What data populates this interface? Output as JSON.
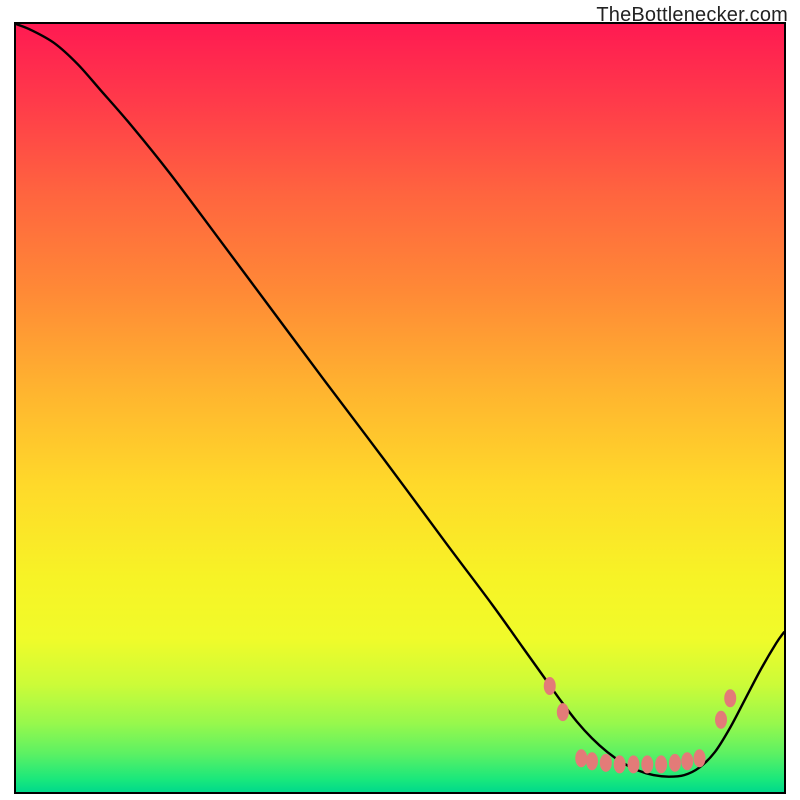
{
  "watermark": "TheBottleneсker.com",
  "chart_data": {
    "type": "line",
    "title": "",
    "xlabel": "",
    "ylabel": "",
    "xlim": [
      0,
      100
    ],
    "ylim": [
      0,
      100
    ],
    "grid": false,
    "gradient": {
      "stops": [
        {
          "offset": 0.0,
          "color": "#ff1a52"
        },
        {
          "offset": 0.1,
          "color": "#ff3a4a"
        },
        {
          "offset": 0.22,
          "color": "#ff643f"
        },
        {
          "offset": 0.35,
          "color": "#ff8a36"
        },
        {
          "offset": 0.48,
          "color": "#ffb52f"
        },
        {
          "offset": 0.6,
          "color": "#ffd92a"
        },
        {
          "offset": 0.72,
          "color": "#f7f326"
        },
        {
          "offset": 0.8,
          "color": "#f0fb2a"
        },
        {
          "offset": 0.86,
          "color": "#ccfb38"
        },
        {
          "offset": 0.91,
          "color": "#98f84c"
        },
        {
          "offset": 0.95,
          "color": "#5cf163"
        },
        {
          "offset": 0.985,
          "color": "#17e77d"
        },
        {
          "offset": 1.0,
          "color": "#00d98b"
        }
      ]
    },
    "series": [
      {
        "name": "curve",
        "stroke": "#000000",
        "stroke_width": 2.4,
        "x": [
          0,
          2,
          5,
          8,
          11,
          15,
          20,
          26,
          33,
          40,
          48,
          56,
          62,
          66,
          69,
          71,
          73,
          75,
          77,
          79,
          81,
          83,
          85,
          87,
          89,
          91,
          93,
          95,
          97,
          99,
          100
        ],
        "y": [
          100,
          99.2,
          97.5,
          94.8,
          91.4,
          86.8,
          80.6,
          72.6,
          63.2,
          53.8,
          43.2,
          32.4,
          24.4,
          18.8,
          14.6,
          11.8,
          9.2,
          7.0,
          5.2,
          3.8,
          2.8,
          2.2,
          2.0,
          2.2,
          3.2,
          5.2,
          8.4,
          12.2,
          16.0,
          19.4,
          20.8
        ]
      }
    ],
    "markers": {
      "color": "#e37b78",
      "rx": 6,
      "ry": 9,
      "points": [
        {
          "x": 69.5,
          "y": 13.8
        },
        {
          "x": 71.2,
          "y": 10.4
        },
        {
          "x": 73.6,
          "y": 4.4
        },
        {
          "x": 75.0,
          "y": 4.0
        },
        {
          "x": 76.8,
          "y": 3.8
        },
        {
          "x": 78.6,
          "y": 3.6
        },
        {
          "x": 80.4,
          "y": 3.6
        },
        {
          "x": 82.2,
          "y": 3.6
        },
        {
          "x": 84.0,
          "y": 3.6
        },
        {
          "x": 85.8,
          "y": 3.8
        },
        {
          "x": 87.4,
          "y": 4.0
        },
        {
          "x": 89.0,
          "y": 4.4
        },
        {
          "x": 91.8,
          "y": 9.4
        },
        {
          "x": 93.0,
          "y": 12.2
        }
      ]
    }
  }
}
